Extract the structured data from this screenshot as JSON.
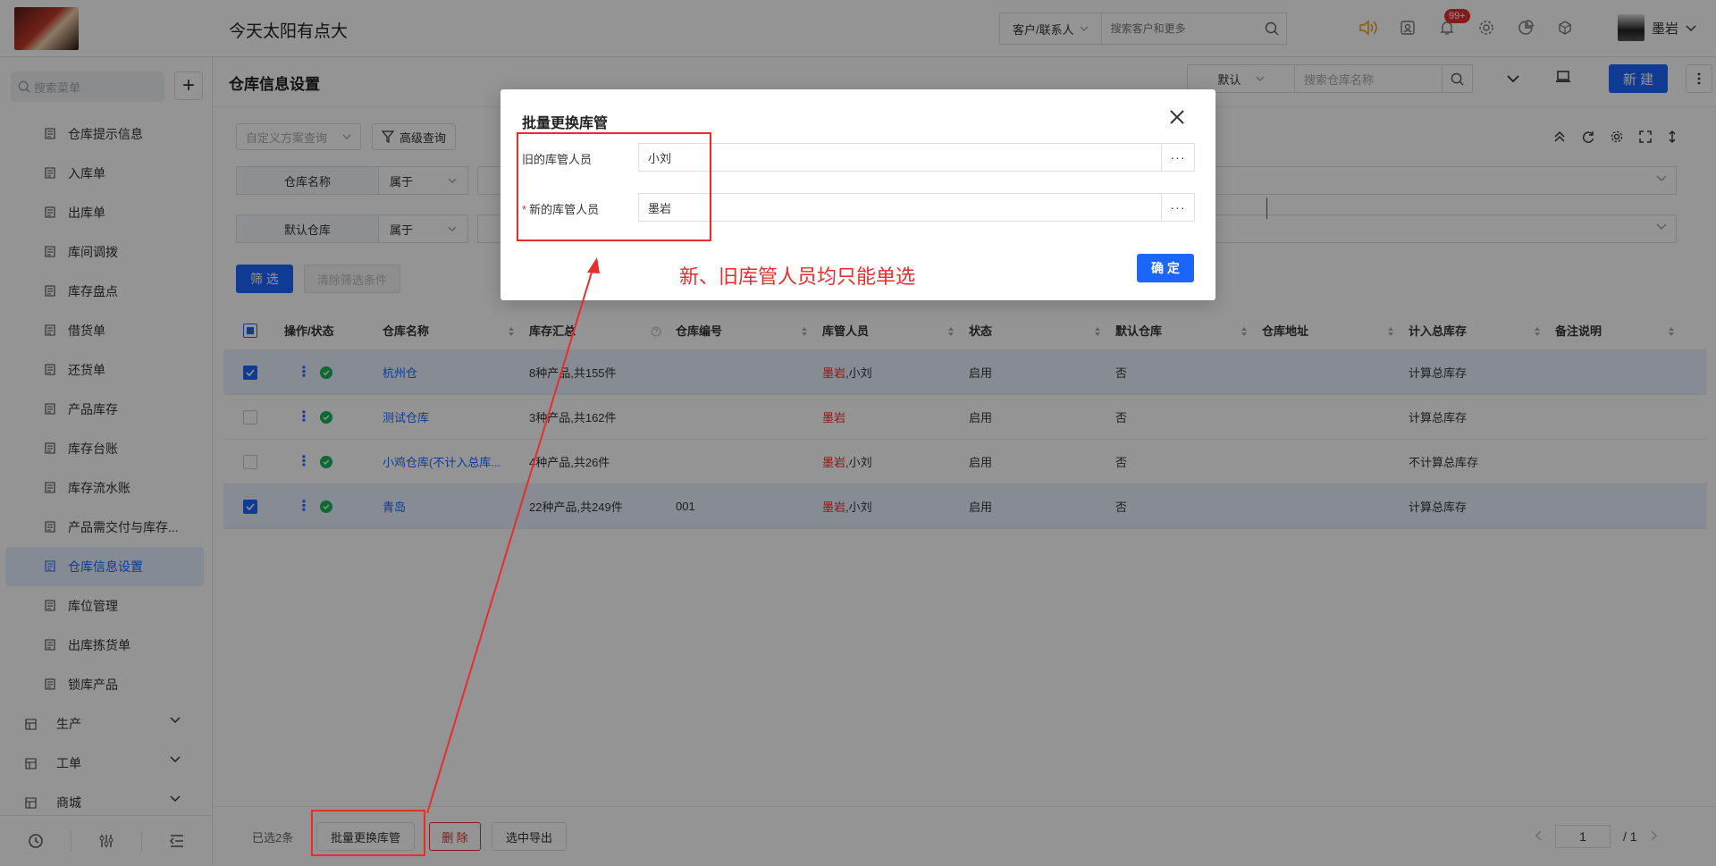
{
  "app": {
    "title": "今天太阳有点大"
  },
  "topbar": {
    "search_type": "客户/联系人",
    "search_placeholder": "搜索客户和更多",
    "notification_badge": "99+",
    "user_name": "墨岩"
  },
  "sidebar": {
    "search_placeholder": "搜索菜单",
    "items": [
      {
        "label": "仓库提示信息",
        "icon": "document-icon"
      },
      {
        "label": "入库单",
        "icon": "inbound-icon"
      },
      {
        "label": "出库单",
        "icon": "outbound-icon"
      },
      {
        "label": "库间调拨",
        "icon": "transfer-icon"
      },
      {
        "label": "库存盘点",
        "icon": "calculator-icon"
      },
      {
        "label": "借货单",
        "icon": "borrow-icon"
      },
      {
        "label": "还货单",
        "icon": "return-icon"
      },
      {
        "label": "产品库存",
        "icon": "product-icon"
      },
      {
        "label": "库存台账",
        "icon": "ledger-icon"
      },
      {
        "label": "库存流水账",
        "icon": "flow-icon"
      },
      {
        "label": "产品需交付与库存...",
        "icon": "book-icon"
      },
      {
        "label": "仓库信息设置",
        "icon": "gear-icon",
        "active": true
      },
      {
        "label": "库位管理",
        "icon": "grid-icon"
      },
      {
        "label": "出库拣货单",
        "icon": "picking-icon"
      },
      {
        "label": "锁库产品",
        "icon": "lock-doc-icon"
      }
    ],
    "groups": [
      {
        "label": "生产",
        "icon": "production-icon"
      },
      {
        "label": "工单",
        "icon": "workorder-icon"
      },
      {
        "label": "商城",
        "icon": "shop-icon"
      }
    ]
  },
  "page": {
    "title": "仓库信息设置",
    "view_select": "默认",
    "search_placeholder": "搜索仓库名称",
    "new_button": "新 建"
  },
  "filters": {
    "scheme_placeholder": "自定义方案查询",
    "advanced_query": "高级查询",
    "rows": [
      {
        "field": "仓库名称",
        "operator": "属于"
      },
      {
        "field": "默认仓库",
        "operator": "属于"
      }
    ],
    "apply_button": "筛 选",
    "clear_button": "清除筛选条件"
  },
  "table": {
    "columns": [
      "操作/状态",
      "仓库名称",
      "库存汇总",
      "仓库编号",
      "库管人员",
      "状态",
      "默认仓库",
      "仓库地址",
      "计入总库存",
      "备注说明"
    ],
    "rows": [
      {
        "selected": true,
        "name": "杭州仓",
        "summary": "8种产品,共155件",
        "code": "",
        "keeper_new": "墨岩",
        "keeper_old": ",小刘",
        "status": "启用",
        "default": "否",
        "address": "",
        "total": "计算总库存",
        "remark": ""
      },
      {
        "selected": false,
        "name": "测试仓库",
        "summary": "3种产品,共162件",
        "code": "",
        "keeper_new": "墨岩",
        "keeper_old": "",
        "status": "启用",
        "default": "否",
        "address": "",
        "total": "计算总库存",
        "remark": ""
      },
      {
        "selected": false,
        "name": "小鸡仓库(不计入总库...",
        "summary": "4种产品,共26件",
        "code": "",
        "keeper_new": "墨岩",
        "keeper_old": ",小刘",
        "status": "启用",
        "default": "否",
        "address": "",
        "total": "不计算总库存",
        "remark": ""
      },
      {
        "selected": true,
        "name": "青岛",
        "summary": "22种产品,共249件",
        "code": "001",
        "keeper_new": "墨岩",
        "keeper_old": ",小刘",
        "status": "启用",
        "default": "否",
        "address": "",
        "total": "计算总库存",
        "remark": ""
      }
    ]
  },
  "footer": {
    "selected_count": "已选2条",
    "batch_button": "批量更换库管",
    "delete_button": "删 除",
    "export_button": "选中导出",
    "page_current": "1",
    "page_total": "/ 1"
  },
  "modal": {
    "title": "批量更换库管",
    "old_label": "旧的库管人员",
    "old_value": "小刘",
    "new_required": "*",
    "new_label": "新的库管人员",
    "new_value": "墨岩",
    "dots": "···",
    "confirm_button": "确 定"
  },
  "annotation": {
    "text": "新、旧库管人员均只能单选",
    "color": "#e62e2e"
  },
  "colors": {
    "primary": "#1a66ff",
    "danger": "#e62e2e",
    "success": "#19b35a"
  }
}
